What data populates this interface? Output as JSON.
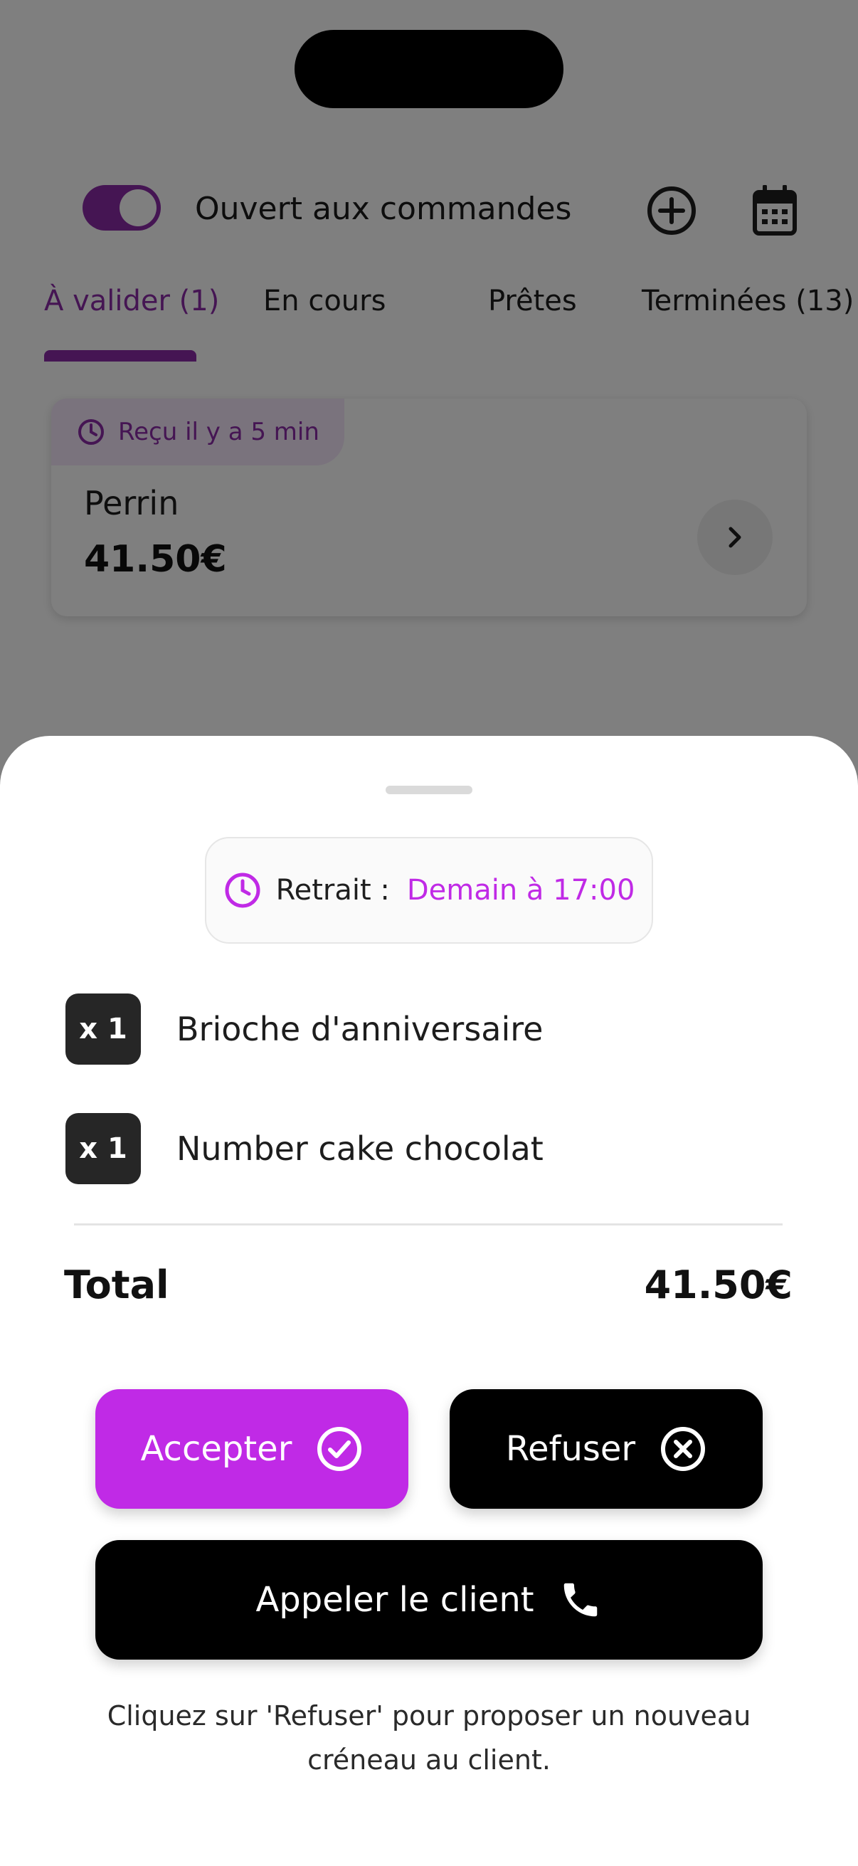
{
  "header": {
    "open_label": "Ouvert aux commandes",
    "toggle_on": true
  },
  "tabs": [
    {
      "label": "À valider (1)",
      "active": true
    },
    {
      "label": "En cours",
      "active": false
    },
    {
      "label": "Prêtes",
      "active": false
    },
    {
      "label": "Terminées (13)",
      "active": false
    }
  ],
  "order_card": {
    "received": "Reçu il y a 5 min",
    "client": "Perrin",
    "amount": "41.50€"
  },
  "sheet": {
    "pickup_label": "Retrait :",
    "pickup_value": "Demain à 17:00",
    "items": [
      {
        "qty": "x 1",
        "name": "Brioche d'anniversaire"
      },
      {
        "qty": "x 1",
        "name": "Number cake chocolat"
      }
    ],
    "total_label": "Total",
    "total_value": "41.50€",
    "accept_label": "Accepter",
    "refuse_label": "Refuser",
    "call_label": "Appeler le client",
    "hint": "Cliquez sur 'Refuser' pour proposer un nouveau créneau au client."
  },
  "colors": {
    "brand_purple": "#8a2ba7",
    "accent_magenta": "#c02ae6",
    "dark": "#000000"
  },
  "icons": {
    "add": "plus-circle-icon",
    "calendar": "calendar-icon",
    "clock": "clock-icon",
    "chevron": "chevron-right-icon",
    "check": "check-circle-icon",
    "close": "close-circle-icon",
    "phone": "phone-icon"
  }
}
